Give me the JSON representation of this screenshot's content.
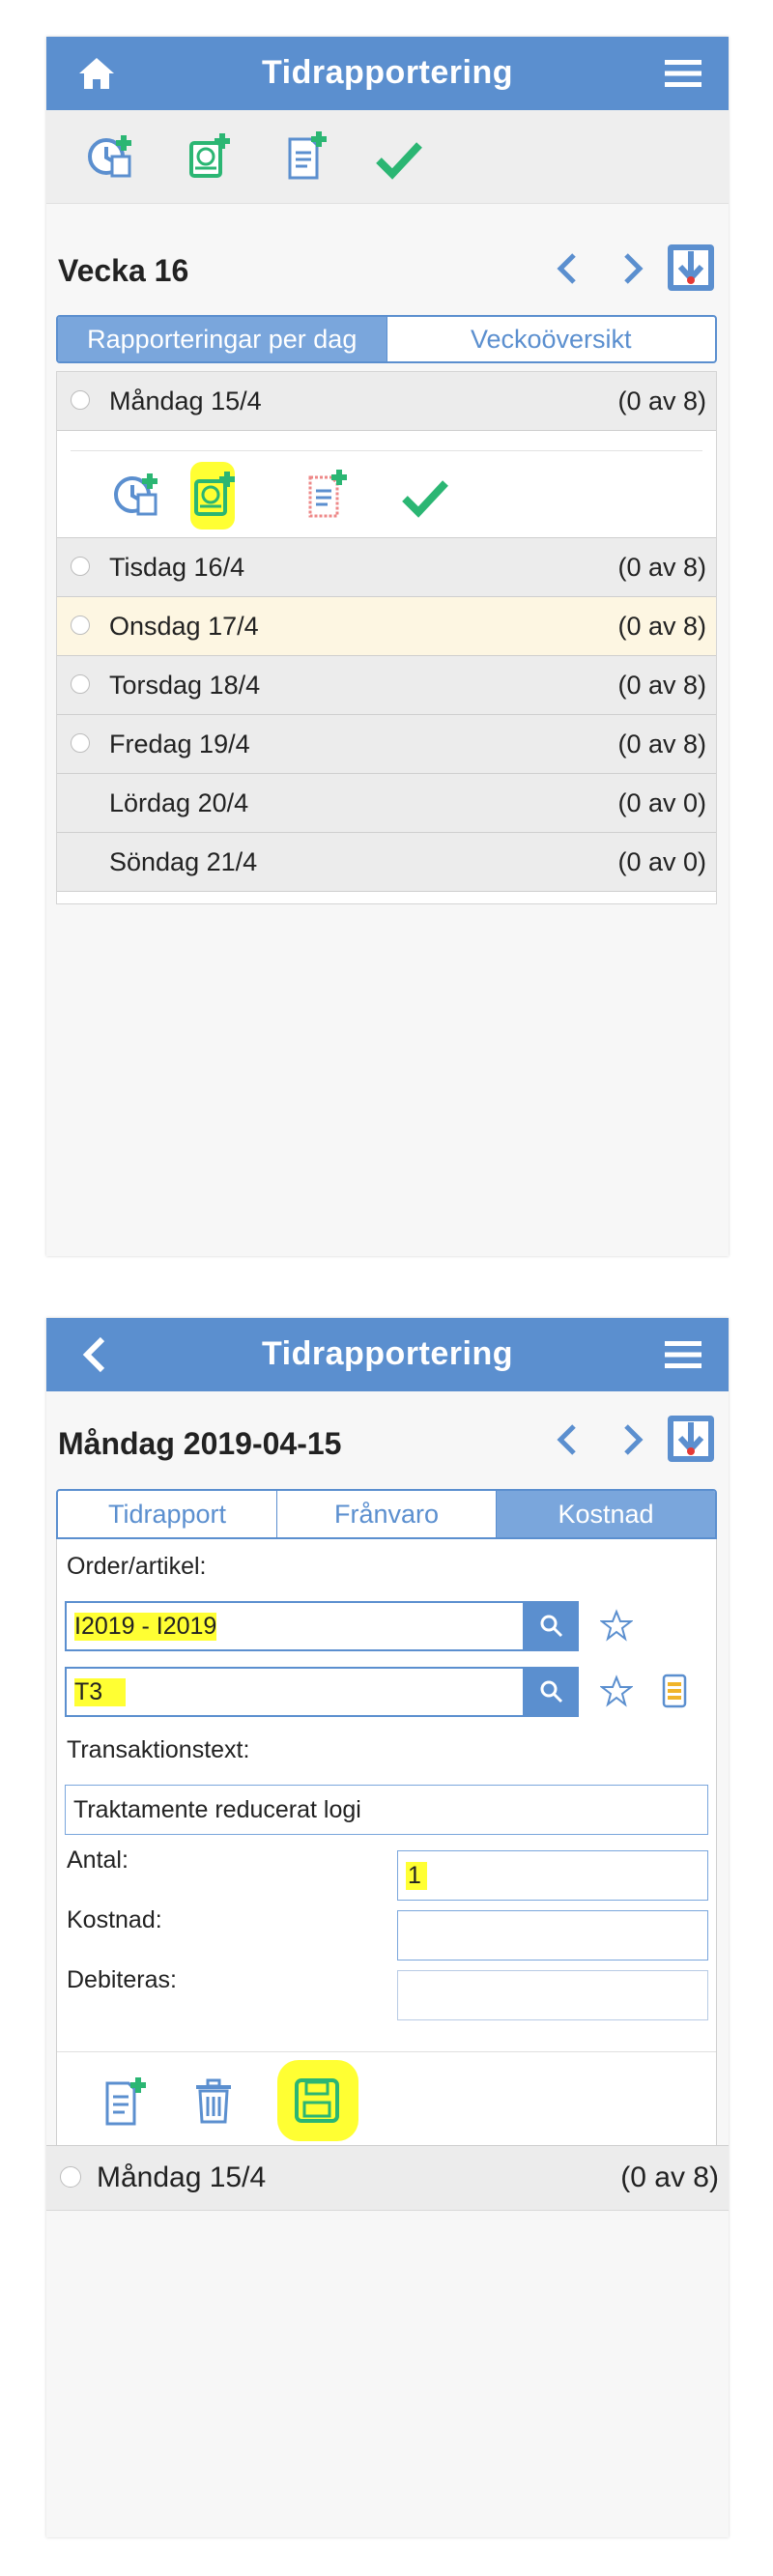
{
  "colors": {
    "accent": "#5b8fcf",
    "highlight": "#ffff33",
    "green_check": "#2bb673"
  },
  "screen1": {
    "header": {
      "title": "Tidrapportering",
      "left_icon": "home-icon",
      "right_icon": "hamburger-menu-icon"
    },
    "toolbar": {
      "icons": [
        "add-time-report-icon",
        "add-expense-icon",
        "add-document-icon",
        "approve-check-icon"
      ]
    },
    "week": {
      "title": "Vecka 16",
      "prev_icon": "chevron-left-icon",
      "next_icon": "chevron-right-icon",
      "download_icon": "download-icon"
    },
    "segments": [
      {
        "label": "Rapporteringar per dag",
        "active": true
      },
      {
        "label": "Veckoöversikt",
        "active": false
      }
    ],
    "days": [
      {
        "name": "Måndag 15/4",
        "count": "(0 av 8)",
        "radio": true,
        "expanded": true
      },
      {
        "name": "Tisdag 16/4",
        "count": "(0 av 8)",
        "radio": true
      },
      {
        "name": "Onsdag 17/4",
        "count": "(0 av 8)",
        "radio": true,
        "highlighted": true
      },
      {
        "name": "Torsdag 18/4",
        "count": "(0 av 8)",
        "radio": true
      },
      {
        "name": "Fredag 19/4",
        "count": "(0 av 8)",
        "radio": true
      },
      {
        "name": "Lördag 20/4",
        "count": "(0 av 0)",
        "radio": false
      },
      {
        "name": "Söndag 21/4",
        "count": "(0 av 0)",
        "radio": false
      }
    ],
    "day_actions": {
      "icons": [
        "add-time-report-icon",
        "add-expense-icon",
        "add-document-icon",
        "approve-check-icon"
      ],
      "highlighted_index": 1
    }
  },
  "screen2": {
    "header": {
      "title": "Tidrapportering",
      "left_icon": "back-chevron-icon",
      "right_icon": "hamburger-menu-icon"
    },
    "date": {
      "title": "Måndag 2019-04-15"
    },
    "tabs": [
      {
        "label": "Tidrapport",
        "active": false
      },
      {
        "label": "Frånvaro",
        "active": false
      },
      {
        "label": "Kostnad",
        "active": true
      }
    ],
    "form": {
      "order_label": "Order/artikel:",
      "order_value": "I2019 - I2019",
      "article_value": "T3",
      "transaction_label": "Transaktionstext:",
      "transaction_value": "Traktamente reducerat logi",
      "antal_label": "Antal:",
      "antal_value": "1",
      "kostnad_label": "Kostnad:",
      "kostnad_value": "",
      "debiteras_label": "Debiteras:",
      "debiteras_value": ""
    },
    "footer_icons": [
      "add-document-icon",
      "trash-icon",
      "save-icon"
    ],
    "day_row": {
      "name": "Måndag 15/4",
      "count": "(0 av 8)"
    }
  }
}
